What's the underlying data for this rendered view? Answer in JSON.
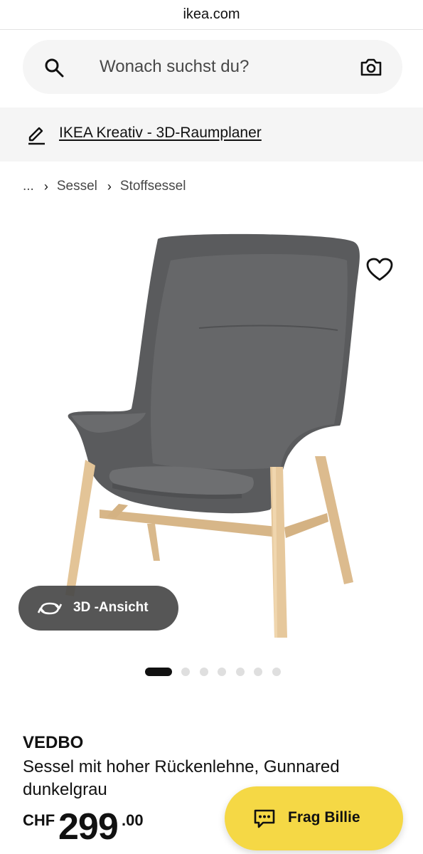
{
  "browser": {
    "url": "ikea.com"
  },
  "search": {
    "placeholder": "Wonach suchst du?"
  },
  "planner": {
    "label": "IKEA Kreativ - 3D-Raumplaner"
  },
  "breadcrumb": {
    "items": [
      "...",
      "Sessel",
      "Stoffsessel"
    ]
  },
  "gallery": {
    "view3d_label": "3D -Ansicht",
    "image_count": 7,
    "active_index": 1
  },
  "product": {
    "name": "VEDBO",
    "description": "Sessel mit hoher Rückenlehne, Gunnared dunkelgrau",
    "price": {
      "currency": "CHF",
      "integer": "299",
      "decimal": ".00"
    }
  },
  "chat": {
    "label": "Frag Billie"
  },
  "colors": {
    "accent_yellow": "#f5d845",
    "chair_fabric": "#5a5b5d",
    "wood": "#e3c497"
  },
  "icons": [
    "search-icon",
    "camera-icon",
    "pen-icon",
    "chevron-right-icon",
    "heart-icon",
    "rotate-3d-icon",
    "chat-bubble-icon"
  ]
}
